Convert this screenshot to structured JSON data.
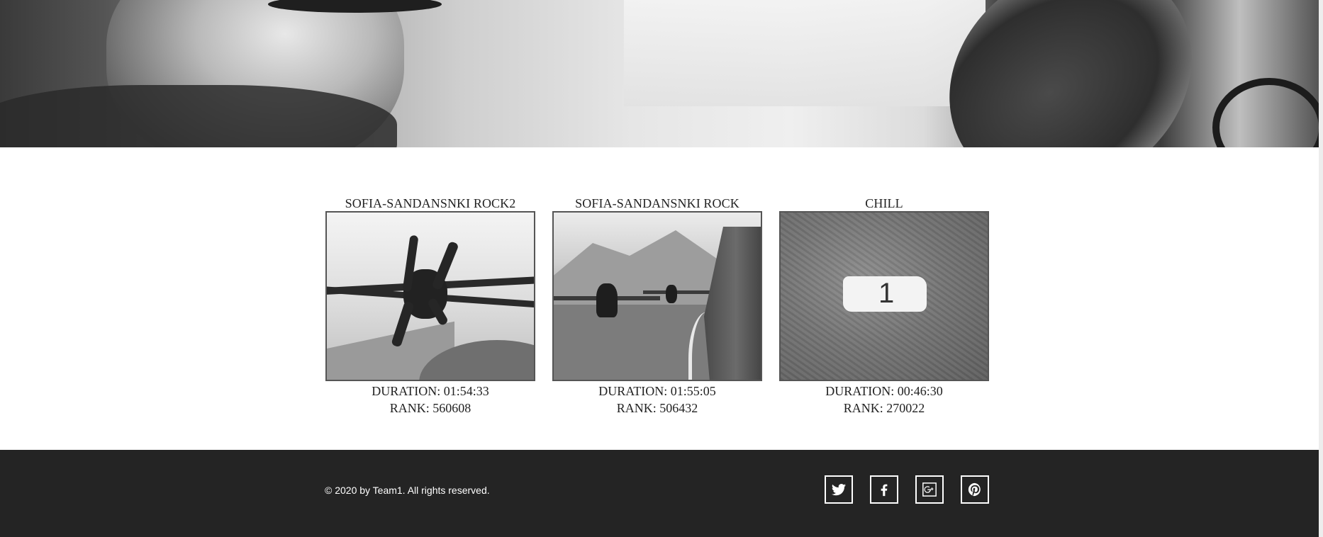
{
  "gallery": {
    "items": [
      {
        "title": "SOFIA-SANDANSNKI ROCK2",
        "duration": "DURATION: 01:54:33",
        "rank": "RANK: 560608"
      },
      {
        "title": "SOFIA-SANDANSNKI ROCK",
        "duration": "DURATION: 01:55:05",
        "rank": "RANK: 506432"
      },
      {
        "title": "CHILL",
        "duration": "DURATION: 00:46:30",
        "rank": "RANK: 270022"
      }
    ]
  },
  "footer": {
    "copyright": "© 2020 by Team1. All rights reserved.",
    "social": [
      {
        "icon": "twitter-icon"
      },
      {
        "icon": "facebook-icon"
      },
      {
        "icon": "google-plus-icon"
      },
      {
        "icon": "pinterest-icon"
      }
    ]
  },
  "colors": {
    "footer_bg": "#242424",
    "text": "#222222",
    "thumb_border": "#555555"
  }
}
